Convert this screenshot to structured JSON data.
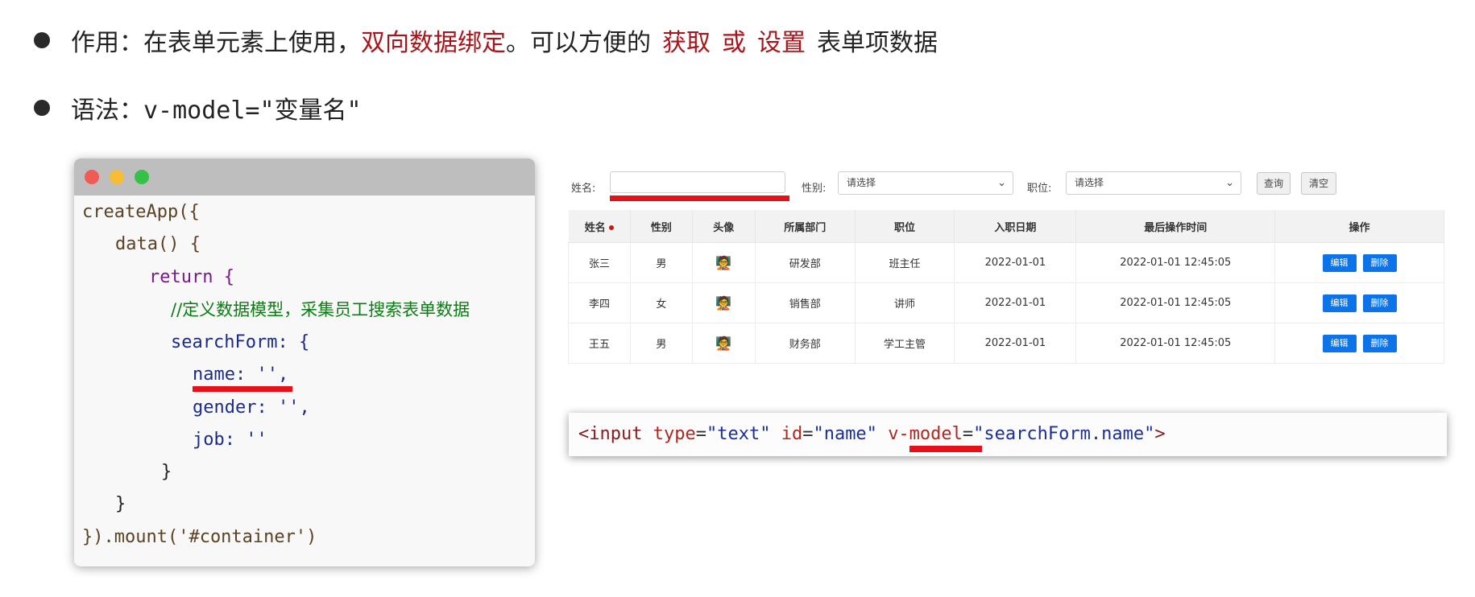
{
  "bullet1": {
    "prefix": "作用：在表单元素上使用，",
    "highlight": "双向数据绑定",
    "middle": "。可以方便的",
    "get": "获取",
    "or": "或",
    "set": "设置",
    "suffix": "表单项数据"
  },
  "bullet2": {
    "prefix": "语法：",
    "code": "v-model=\"变量名\""
  },
  "code_window": {
    "lines": [
      {
        "t": "createApp({"
      },
      {
        "t": "data() {"
      },
      {
        "t": "return {"
      },
      {
        "t": "//定义数据模型，采集员工搜索表单数据"
      },
      {
        "t": "searchForm: {"
      },
      {
        "t": "name: '',"
      },
      {
        "t": "gender: '',"
      },
      {
        "t": "job: ''"
      },
      {
        "t": "}"
      },
      {
        "t": "}"
      },
      {
        "t": "}).mount('#container')"
      }
    ]
  },
  "search_form": {
    "name_label": "姓名:",
    "name_value": "",
    "gender_label": "性别:",
    "gender_selected": "请选择",
    "job_label": "职位:",
    "job_selected": "请选择",
    "query_label": "查询",
    "clear_label": "清空"
  },
  "table": {
    "headers": [
      "姓名",
      "性别",
      "头像",
      "所属部门",
      "职位",
      "入职日期",
      "最后操作时间",
      "操作"
    ],
    "rows": [
      {
        "name": "张三",
        "gender": "男",
        "dept": "研发部",
        "job": "班主任",
        "date": "2022-01-01",
        "updated": "2022-01-01 12:45:05"
      },
      {
        "name": "李四",
        "gender": "女",
        "dept": "销售部",
        "job": "讲师",
        "date": "2022-01-01",
        "updated": "2022-01-01 12:45:05"
      },
      {
        "name": "王五",
        "gender": "男",
        "dept": "财务部",
        "job": "学工主管",
        "date": "2022-01-01",
        "updated": "2022-01-01 12:45:05"
      }
    ],
    "edit_label": "编辑",
    "delete_label": "删除"
  },
  "snippet": {
    "open": "<input",
    "type_attr": "type",
    "type_val": "\"text\"",
    "id_attr": "id",
    "id_val": "\"name\"",
    "vmodel_attr": "v-model",
    "vmodel_val": "\"searchForm.name\"",
    "close": ">"
  },
  "colors": {
    "highlight_red": "#a8151b",
    "underline_red": "#e6101a",
    "button_blue": "#0d73e8"
  }
}
